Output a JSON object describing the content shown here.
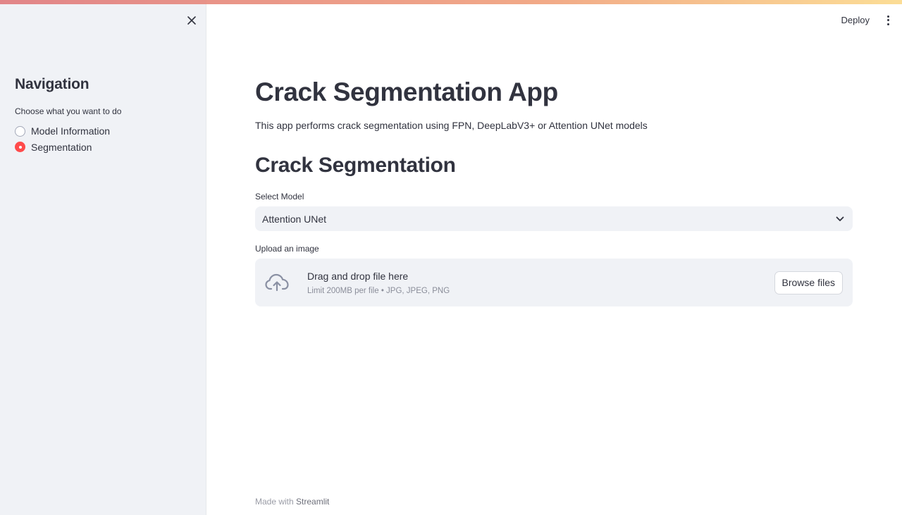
{
  "header": {
    "deploy_label": "Deploy",
    "menu_icon": "kebab-menu-icon"
  },
  "sidebar": {
    "close_icon": "close-icon",
    "title": "Navigation",
    "prompt": "Choose what you want to do",
    "options": [
      {
        "label": "Model Information",
        "selected": false
      },
      {
        "label": "Segmentation",
        "selected": true
      }
    ]
  },
  "main": {
    "title": "Crack Segmentation App",
    "description": "This app performs crack segmentation using FPN, DeepLabV3+ or Attention UNet models",
    "section_title": "Crack Segmentation",
    "select": {
      "label": "Select Model",
      "value": "Attention UNet",
      "icon": "chevron-down-icon"
    },
    "uploader": {
      "label": "Upload an image",
      "icon": "cloud-upload-icon",
      "title": "Drag and drop file here",
      "limit": "Limit 200MB per file • JPG, JPEG, PNG",
      "button_label": "Browse files"
    }
  },
  "footer": {
    "prefix": "Made with",
    "brand": "Streamlit"
  },
  "colors": {
    "accent": "#ff4b4b",
    "sidebar_bg": "#f0f2f6",
    "text": "#31333f"
  }
}
